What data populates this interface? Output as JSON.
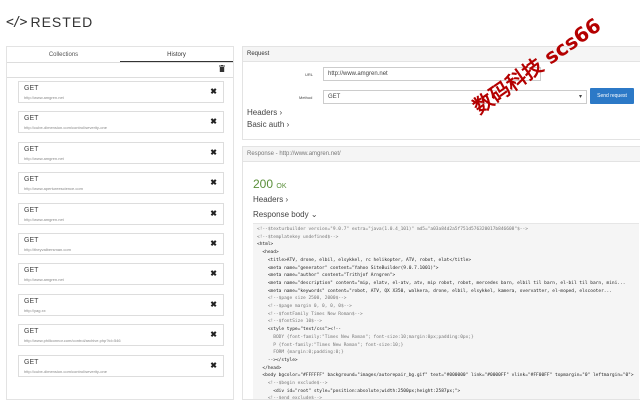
{
  "app": {
    "logo_icon": "</>",
    "title": "RESTED"
  },
  "left_panel": {
    "tabs": [
      {
        "label": "Collections",
        "active": false
      },
      {
        "label": "History",
        "active": true
      }
    ],
    "history": [
      {
        "method": "GET",
        "url": "http://www.amgren.net"
      },
      {
        "method": "GET",
        "url": "http://cube-dimension.com/control/severity-one"
      },
      {
        "method": "GET",
        "url": "http://www.amgren.net"
      },
      {
        "method": "GET",
        "url": "http://www.apertureescience.com"
      },
      {
        "method": "GET",
        "url": "http://www.amgren.net"
      },
      {
        "method": "GET",
        "url": "http://theyvalbersman.com"
      },
      {
        "method": "GET",
        "url": "http://www.amgren.net"
      },
      {
        "method": "GET",
        "url": "http://yag.xx"
      },
      {
        "method": "GET",
        "url": "http://www.phillconnor.com/control/archive.php?id=546"
      },
      {
        "method": "GET",
        "url": "http://cube-dimension.com/control/severity-one"
      }
    ]
  },
  "request": {
    "heading": "Request",
    "url_label": "URL",
    "url_value": "http://www.amgren.net",
    "method_label": "Method",
    "method_value": "GET",
    "send_label": "Send request",
    "headers_label": "Headers",
    "basic_auth_label": "Basic auth"
  },
  "response": {
    "heading": "Response - http://www.amgren.net/",
    "status_code": "200",
    "status_text": "OK",
    "headers_label": "Headers",
    "body_label": "Response body",
    "body_lines": [
      {
        "text": "<!--$texturbuilder version=\"9.0.7\" extra=\"java(1.0.4_101)\" md5=\"a03a84d2a5f751d576320017b846608\"$-->",
        "comment": true
      },
      {
        "text": "<!--$templatekey undefined$-->",
        "comment": true
      },
      {
        "text": "<html>",
        "comment": false
      },
      {
        "text": "  <head>",
        "comment": false
      },
      {
        "text": "    <title>ATV, drone, elbil, elsykkel, rc helikopter, ATV, robot, elat</title>",
        "comment": false
      },
      {
        "text": "    <meta name=\"generator\" content=\"Yahoo SiteBuilder(9.0.7.1001)\">",
        "comment": false
      },
      {
        "text": "    <meta name=\"author\" content=\"Trithjof Arngren\">",
        "comment": false
      },
      {
        "text": "    <meta name=\"description\" content=\"mip, elatv, el-atv, atv, mip robot, robot, mercedes barn, elbil til barn, el-bil til barn, mini...",
        "comment": false
      },
      {
        "text": "    <meta name=\"keywords\" content=\"robot, ATV, QX X350, walkera, drone, elbil, elsykkel, kamera, overvatter, el-moped, elscooter...",
        "comment": false
      },
      {
        "text": "    <!--$page size 2500, 2000$-->",
        "comment": true
      },
      {
        "text": "    <!--$page margin 0, 0, 0, 0$-->",
        "comment": true
      },
      {
        "text": "    <!--$fontFamily Times New Roman$-->",
        "comment": true
      },
      {
        "text": "    <!--$fontSize 10$-->",
        "comment": true
      },
      {
        "text": "    <style type=\"text/css\"><!--",
        "comment": false
      },
      {
        "text": "      BODY {font-family:\"Times New Roman\"; font-size:10;margin:0px;padding:0px;}",
        "comment": true
      },
      {
        "text": "      P {font-family:\"Times New Roman\"; font-size:10;}",
        "comment": true
      },
      {
        "text": "      FORM {margin:0;padding:0;}",
        "comment": true
      },
      {
        "text": "    --></style>",
        "comment": false
      },
      {
        "text": "  </head>",
        "comment": false
      },
      {
        "text": "  <body bgcolor=\"#FFFFFF\" background=\"images/autorepair_bg.gif\" text=\"#000000\" link=\"#0000FF\" vlink=\"#FF00FF\" topmargin=\"0\" leftmargin=\"0\">",
        "comment": false
      },
      {
        "text": "",
        "comment": false
      },
      {
        "text": "    <!--$begin exclude$-->",
        "comment": true
      },
      {
        "text": "      <div id=\"root\" style=\"position:absolute;width:2500px;height:2587px;\">",
        "comment": false
      },
      {
        "text": "    <!--$end exclude$-->",
        "comment": true
      }
    ]
  },
  "watermark": "数码科技 scs66",
  "colors": {
    "accent": "#2c79c7",
    "status_ok": "#5a8f3a",
    "watermark": "#b40000"
  },
  "icons": {
    "trash": "trash-icon",
    "remove": "close-icon",
    "chevron": "chevron-down-icon"
  }
}
